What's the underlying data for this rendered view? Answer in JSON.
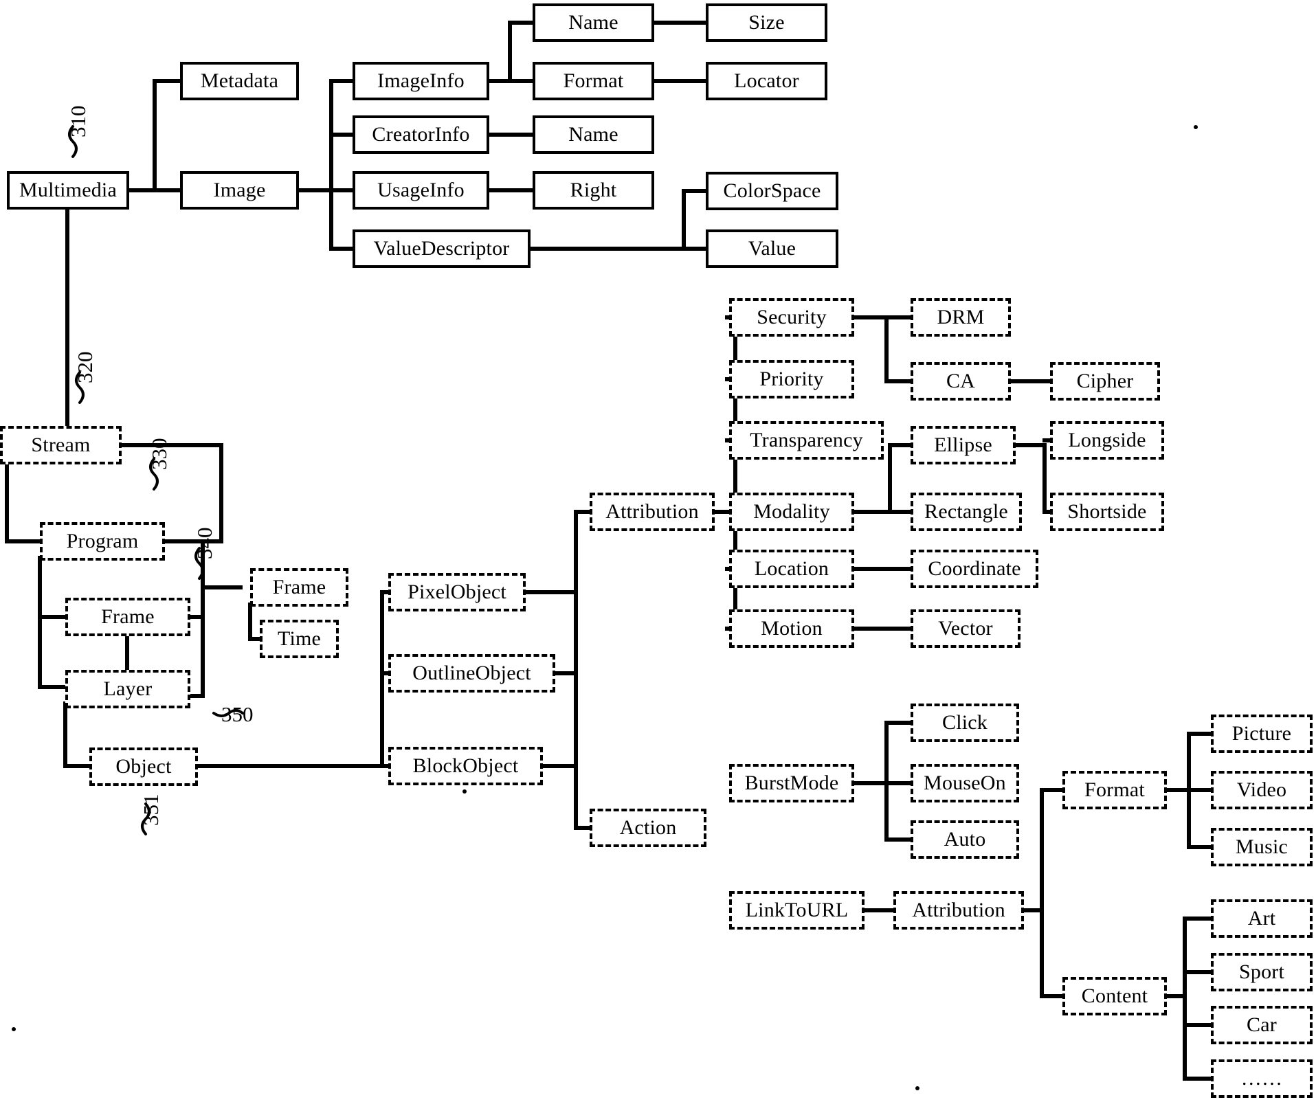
{
  "figure": {
    "type": "hierarchical-tree-diagram",
    "style": "patent-line-drawing",
    "line_color": "#000000",
    "background_color": "#ffffff",
    "solid_border_meaning": "image branch nodes",
    "dashed_border_meaning": "stream branch nodes"
  },
  "reference_numerals": [
    "310",
    "320",
    "330",
    "340",
    "350",
    "351"
  ],
  "refs": {
    "r310": "310",
    "r320": "320",
    "r330": "330",
    "r340": "340",
    "r350": "350",
    "r351": "351"
  },
  "nodes": {
    "multimedia": "Multimedia",
    "metadata": "Metadata",
    "image": "Image",
    "imageinfo": "ImageInfo",
    "creatorinfo": "CreatorInfo",
    "usageinfo": "UsageInfo",
    "valuedescriptor": "ValueDescriptor",
    "name1": "Name",
    "format1": "Format",
    "name2": "Name",
    "right": "Right",
    "size": "Size",
    "locator": "Locator",
    "colorspace": "ColorSpace",
    "value": "Value",
    "stream": "Stream",
    "program": "Program",
    "frame_left": "Frame",
    "layer": "Layer",
    "object": "Object",
    "frame_right": "Frame",
    "time": "Time",
    "pixelobject": "PixelObject",
    "outlineobject": "OutlineObject",
    "blockobject": "BlockObject",
    "attribution1": "Attribution",
    "action": "Action",
    "security": "Security",
    "priority": "Priority",
    "transparency": "Transparency",
    "modality": "Modality",
    "location": "Location",
    "motion": "Motion",
    "drm": "DRM",
    "ca": "CA",
    "cipher": "Cipher",
    "ellipse": "Ellipse",
    "rectangle": "Rectangle",
    "longside": "Longside",
    "shortside": "Shortside",
    "coordinate": "Coordinate",
    "vector": "Vector",
    "burstmode": "BurstMode",
    "click": "Click",
    "mouseon": "MouseOn",
    "auto": "Auto",
    "linktourl": "LinkToURL",
    "attribution2": "Attribution",
    "format2": "Format",
    "content": "Content",
    "picture": "Picture",
    "video": "Video",
    "music": "Music",
    "art": "Art",
    "sport": "Sport",
    "car": "Car",
    "ellipsis": "……"
  },
  "tree": {
    "Multimedia": [
      "Metadata",
      "Image",
      "Stream"
    ],
    "Image": [
      "ImageInfo",
      "CreatorInfo",
      "UsageInfo",
      "ValueDescriptor"
    ],
    "ImageInfo": [
      "Name",
      "Format"
    ],
    "CreatorInfo": [
      "Name"
    ],
    "UsageInfo": [
      "Right"
    ],
    "ValueDescriptor": [
      "ColorSpace",
      "Value"
    ],
    "Name": [
      "Size"
    ],
    "Format": [
      "Locator"
    ],
    "Stream": [
      "Program"
    ],
    "Program": [
      "Frame",
      "Layer"
    ],
    "Frame": [
      "Frame",
      "Time",
      "Layer"
    ],
    "Layer": [
      "Object"
    ],
    "Object": [
      "PixelObject",
      "OutlineObject",
      "BlockObject"
    ],
    "BlockObject": [
      "Attribution",
      "Action"
    ],
    "Attribution": [
      "Security",
      "Priority",
      "Transparency",
      "Modality",
      "Location",
      "Motion"
    ],
    "Security": [
      "DRM",
      "CA"
    ],
    "CA": [
      "Cipher"
    ],
    "Modality": [
      "Ellipse",
      "Rectangle"
    ],
    "Ellipse": [
      "Longside",
      "Shortside"
    ],
    "Location": [
      "Coordinate"
    ],
    "Motion": [
      "Vector"
    ],
    "BurstMode": [
      "Click",
      "MouseOn",
      "Auto"
    ],
    "LinkToURL": [
      "Attribution2"
    ],
    "Attribution2": [
      "Format",
      "Content"
    ],
    "Format2": [
      "Picture",
      "Video",
      "Music"
    ],
    "Content": [
      "Art",
      "Sport",
      "Car",
      "……"
    ]
  }
}
